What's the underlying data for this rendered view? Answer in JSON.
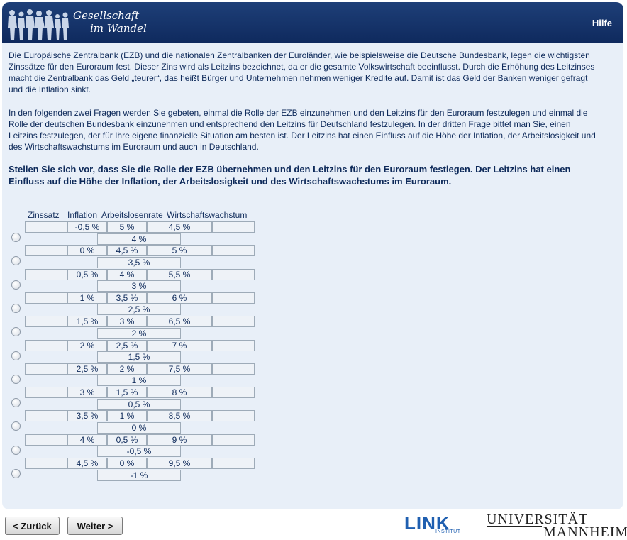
{
  "header": {
    "logo_line1": "Gesellschaft",
    "logo_line2": "im Wandel",
    "help_label": "Hilfe"
  },
  "intro": {
    "paragraph1": "Die Europäische Zentralbank (EZB) und die nationalen Zentralbanken der Euroländer, wie beispielsweise die Deutsche Bundesbank, legen die wichtigsten Zinssätze für den Euroraum fest. Dieser Zins wird als Leitzins bezeichnet, da er die gesamte Volkswirtschaft beeinflusst. Durch die Erhöhung des Leitzinses macht die Zentralbank das Geld „teurer“, das heißt Bürger und Unternehmen nehmen weniger Kredite auf. Damit ist das Geld der Banken weniger gefragt und die Inflation sinkt.",
    "paragraph2": "In den folgenden zwei Fragen werden Sie gebeten, einmal die Rolle der EZB einzunehmen und den Leitzins für den Euroraum festzulegen und einmal die Rolle der deutschen Bundesbank einzunehmen und entsprechend den Leitzins für Deutschland festzulegen. In der dritten Frage bittet man Sie, einen Leitzins festzulegen, der für Ihre eigene finanzielle Situation am besten ist. Der Leitzins hat einen Einfluss auf die Höhe der Inflation, der Arbeitslosigkeit und des Wirtschaftswachstums im Euroraum und auch in Deutschland."
  },
  "question": "Stellen Sie sich vor, dass Sie die Rolle der EZB übernehmen und den Leitzins für den Euroraum festlegen. Der Leitzins hat einen Einfluss auf die Höhe der Inflation, der Arbeitslosigkeit und des Wirtschaftswachstums im Euroraum.",
  "table": {
    "headers": [
      "Zinssatz",
      "Inflation",
      "Arbeitslosenrate",
      "Wirtschaftswachstum"
    ],
    "options": [
      {
        "inflation": "-0,5 %",
        "unemployment": "5 %",
        "growth": "4,5 %",
        "rate": "4 %"
      },
      {
        "inflation": "0 %",
        "unemployment": "4,5 %",
        "growth": "5 %",
        "rate": "3,5 %"
      },
      {
        "inflation": "0,5 %",
        "unemployment": "4 %",
        "growth": "5,5 %",
        "rate": "3 %"
      },
      {
        "inflation": "1 %",
        "unemployment": "3,5 %",
        "growth": "6 %",
        "rate": "2,5 %"
      },
      {
        "inflation": "1,5 %",
        "unemployment": "3 %",
        "growth": "6,5 %",
        "rate": "2 %"
      },
      {
        "inflation": "2 %",
        "unemployment": "2,5 %",
        "growth": "7 %",
        "rate": "1,5 %"
      },
      {
        "inflation": "2,5 %",
        "unemployment": "2 %",
        "growth": "7,5 %",
        "rate": "1 %"
      },
      {
        "inflation": "3 %",
        "unemployment": "1,5 %",
        "growth": "8 %",
        "rate": "0,5 %"
      },
      {
        "inflation": "3,5 %",
        "unemployment": "1 %",
        "growth": "8,5 %",
        "rate": "0 %"
      },
      {
        "inflation": "4 %",
        "unemployment": "0,5 %",
        "growth": "9 %",
        "rate": "-0,5 %"
      },
      {
        "inflation": "4,5 %",
        "unemployment": "0 %",
        "growth": "9,5 %",
        "rate": "-1 %"
      }
    ]
  },
  "nav": {
    "back_label": "< Zurück",
    "next_label": "Weiter >"
  },
  "footer": {
    "link_logo": "LINK",
    "link_sub": "INSTITUT",
    "uni_line1": "UNIVERSITÄT",
    "uni_line2": "MANNHEIM"
  }
}
